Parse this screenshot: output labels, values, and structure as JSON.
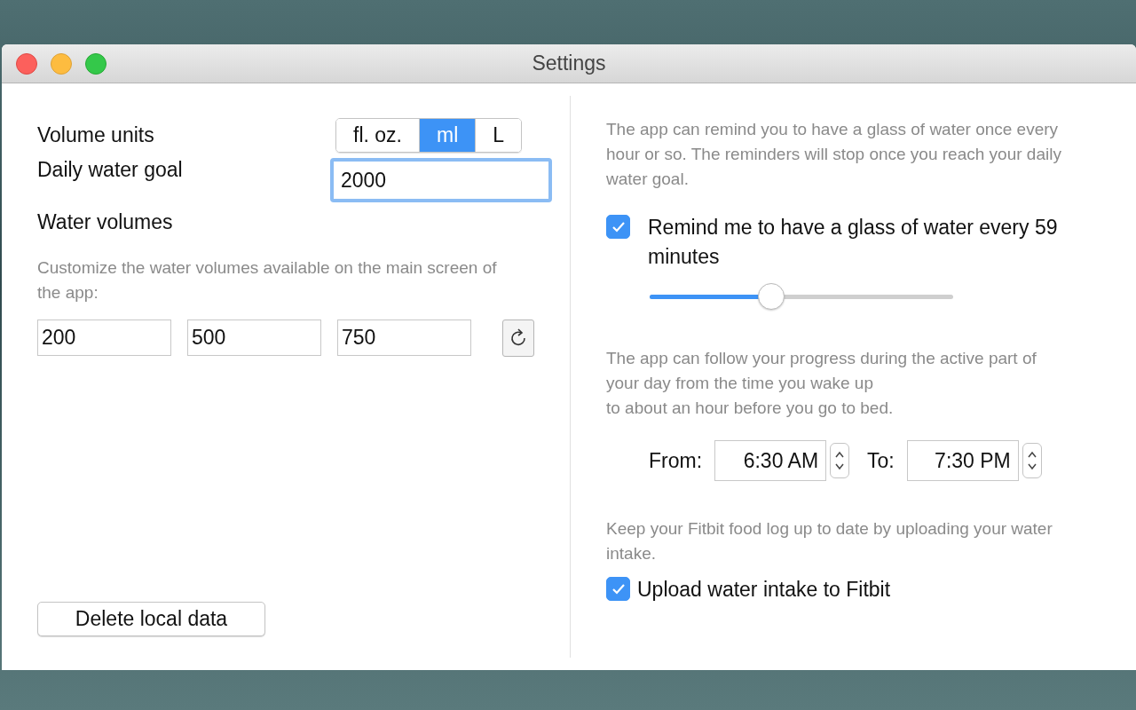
{
  "window": {
    "title": "Settings"
  },
  "left": {
    "volume_units": {
      "label": "Volume units",
      "options": [
        {
          "label": "fl. oz.",
          "selected": false
        },
        {
          "label": "ml",
          "selected": true
        },
        {
          "label": "L",
          "selected": false
        }
      ]
    },
    "daily_goal": {
      "label": "Daily water goal",
      "value": "2000"
    },
    "water_volumes": {
      "label": "Water volumes",
      "description": "Customize the water volumes available on the main screen of the app:",
      "values": [
        "200",
        "500",
        "750"
      ]
    },
    "delete_button": "Delete local data"
  },
  "right": {
    "reminder_description": "The app can remind you to have a glass of water once every hour or so. The reminders will stop once you reach your daily water goal.",
    "reminder": {
      "label": "Remind me to have a glass of water every 59 minutes",
      "checked": true,
      "level": 0.4
    },
    "progress_description": "The app can follow your progress during the active part of your day from the time you wake up\nto about an hour before you go to bed.",
    "from": {
      "label": "From:",
      "value": "6:30 AM"
    },
    "to": {
      "label": "To:",
      "value": "7:30 PM"
    },
    "fitbit_description": "Keep your Fitbit food log up to date by uploading your water intake.",
    "fitbit": {
      "label": "Upload water intake to Fitbit",
      "checked": true
    }
  }
}
